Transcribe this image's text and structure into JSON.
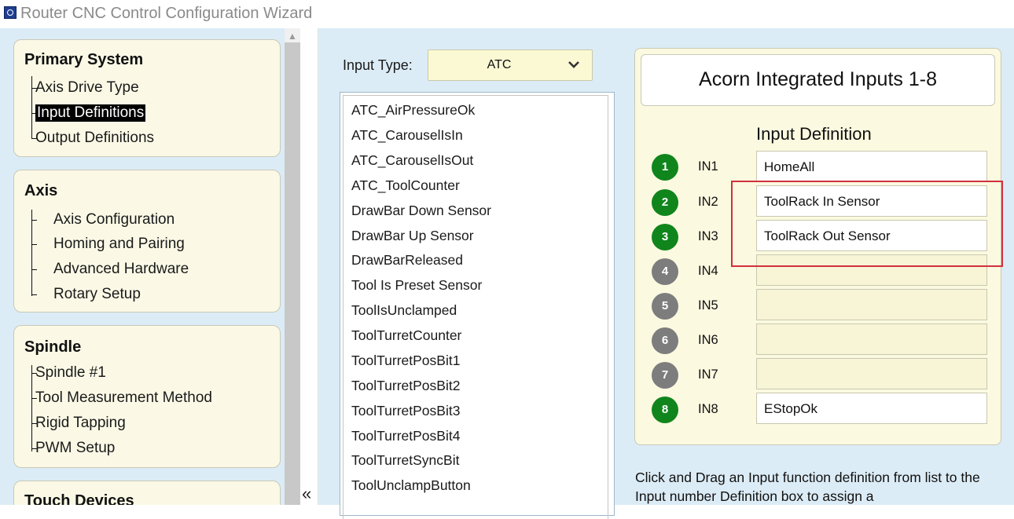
{
  "window": {
    "title": "Router CNC Control Configuration Wizard"
  },
  "sidebar": {
    "sections": [
      {
        "title": "Primary System",
        "items": [
          "Axis Drive Type",
          "Input Definitions",
          "Output Definitions"
        ],
        "selected": "Input Definitions"
      },
      {
        "title": "Axis",
        "items": [
          "Axis Configuration",
          "Homing and Pairing",
          "Advanced Hardware",
          "Rotary Setup"
        ]
      },
      {
        "title": "Spindle",
        "items": [
          "Spindle #1",
          "Tool Measurement Method",
          "Rigid Tapping",
          "PWM Setup"
        ]
      },
      {
        "title": "Touch Devices",
        "items": []
      }
    ],
    "collapse_glyph": "«"
  },
  "input_type": {
    "label": "Input Type:",
    "value": "ATC"
  },
  "functions_list": [
    "ATC_AirPressureOk",
    "ATC_CarouselIsIn",
    "ATC_CarouselIsOut",
    "ATC_ToolCounter",
    "DrawBar Down Sensor",
    "DrawBar Up Sensor",
    "DrawBarReleased",
    "Tool Is Preset Sensor",
    "ToolIsUnclamped",
    "ToolTurretCounter",
    "ToolTurretPosBit1",
    "ToolTurretPosBit2",
    "ToolTurretPosBit3",
    "ToolTurretPosBit4",
    "ToolTurretSyncBit",
    "ToolUnclampButton"
  ],
  "inputs_panel": {
    "header": "Acorn Integrated Inputs 1-8",
    "definition_title": "Input Definition",
    "inputs": [
      {
        "number": "1",
        "label": "IN1",
        "definition": "HomeAll",
        "active": true
      },
      {
        "number": "2",
        "label": "IN2",
        "definition": "ToolRack In Sensor",
        "active": true
      },
      {
        "number": "3",
        "label": "IN3",
        "definition": "ToolRack Out Sensor",
        "active": true
      },
      {
        "number": "4",
        "label": "IN4",
        "definition": "",
        "active": false
      },
      {
        "number": "5",
        "label": "IN5",
        "definition": "",
        "active": false
      },
      {
        "number": "6",
        "label": "IN6",
        "definition": "",
        "active": false
      },
      {
        "number": "7",
        "label": "IN7",
        "definition": "",
        "active": false
      },
      {
        "number": "8",
        "label": "IN8",
        "definition": "EStopOk",
        "active": true
      }
    ],
    "colors": {
      "active_badge": "#10851c",
      "inactive_badge": "#7d7d7d",
      "highlight": "#d0313d"
    }
  },
  "help": {
    "text": "Click and Drag an Input function definition from list to the Input number Definition box to assign a"
  }
}
